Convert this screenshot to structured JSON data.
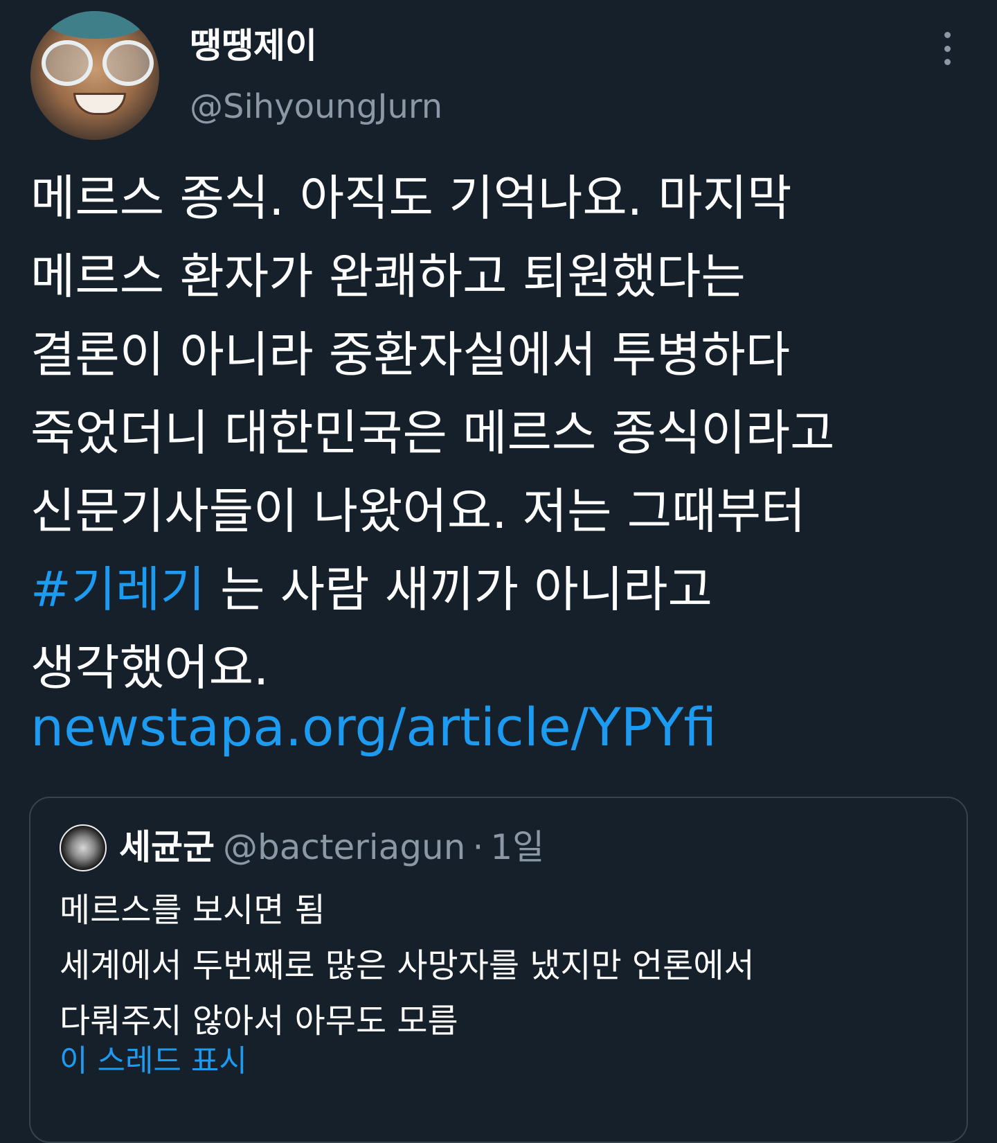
{
  "author": {
    "display_name": "땡땡제이",
    "handle": "@SihyoungJurn"
  },
  "menu": {
    "icon": "more-vertical-icon"
  },
  "tweet": {
    "lines": [
      "메르스 종식. 아직도 기억나요. 마지막",
      "메르스 환자가 완쾌하고 퇴원했다는",
      "결론이 아니라 중환자실에서 투병하다",
      "죽었더니 대한민국은 메르스 종식이라고",
      "신문기사들이 나왔어요. 저는 그때부터"
    ],
    "hashtag": "#기레기",
    "hashtag_line_rest": " 는 사람 새끼가 아니라고",
    "last_line": "생각했어요.",
    "link": "newstapa.org/article/YPYfi"
  },
  "quoted": {
    "display_name": "세균군",
    "handle": "@bacteriagun",
    "separator": "·",
    "time": "1일",
    "lines": [
      "메르스를 보시면 됨",
      "세계에서 두번째로 많은 사망자를 냈지만 언론에서",
      "다뤄주지 않아서 아무도 모름"
    ],
    "show_thread": "이 스레드 표시"
  },
  "colors": {
    "background": "#15202b",
    "link": "#1d9bf0",
    "secondary_text": "#8b98a5",
    "border": "#38444d"
  }
}
